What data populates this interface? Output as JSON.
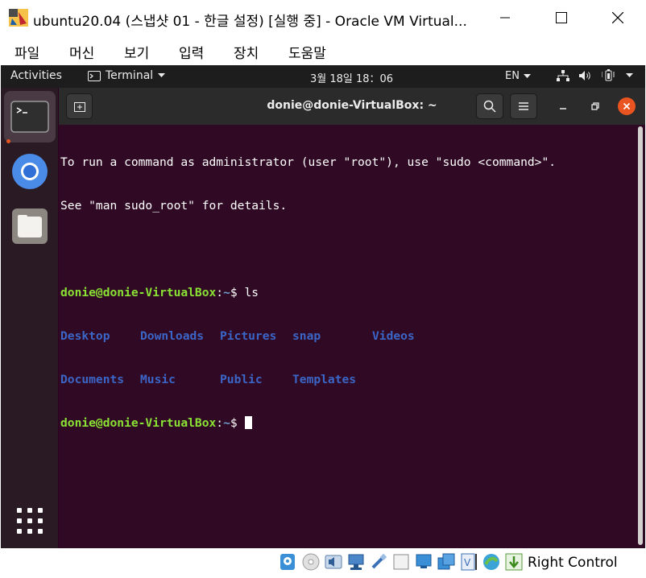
{
  "window": {
    "title": "ubuntu20.04 (스냅샷 01 - 한글 설정) [실행 중] - Oracle VM Virtual...",
    "icon": "virtualbox-app-icon"
  },
  "menubar": {
    "items": [
      "파일",
      "머신",
      "보기",
      "입력",
      "장치",
      "도움말"
    ]
  },
  "gnome_topbar": {
    "activities": "Activities",
    "app_menu": "Terminal",
    "clock": "3월 18일  18：06",
    "input_language": "EN"
  },
  "dock": {
    "items": [
      "terminal-icon",
      "chromium-icon",
      "files-icon"
    ],
    "show_apps": "show-applications-icon"
  },
  "terminal": {
    "title": "donie@donie-VirtualBox: ~",
    "notice_lines": [
      "To run a command as administrator (user \"root\"), use \"sudo <command>\".",
      "See \"man sudo_root\" for details."
    ],
    "prompt_user": "donie@donie-VirtualBox",
    "prompt_colon": ":",
    "prompt_path": "~",
    "prompt_symbol": "$ ",
    "command": "ls",
    "ls_rows": [
      [
        "Desktop",
        "Downloads",
        "Pictures",
        "snap",
        "Videos"
      ],
      [
        "Documents",
        "Music",
        "Public",
        "Templates"
      ]
    ]
  },
  "statusbar": {
    "host_key": "Right Control",
    "icons": [
      "hard-disk-icon",
      "optical-drive-icon",
      "audio-icon",
      "network-icon",
      "usb-icon",
      "shared-folders-icon",
      "display-icon",
      "recording-icon",
      "vrde-icon",
      "cpu-icon",
      "mouse-integration-icon",
      "keyboard-capture-icon"
    ]
  },
  "colors": {
    "terminal_bg": "#300a24",
    "prompt_user": "#8ae234",
    "prompt_path": "#729fcf",
    "directory": "#3b65c6",
    "accent": "#e95420"
  }
}
